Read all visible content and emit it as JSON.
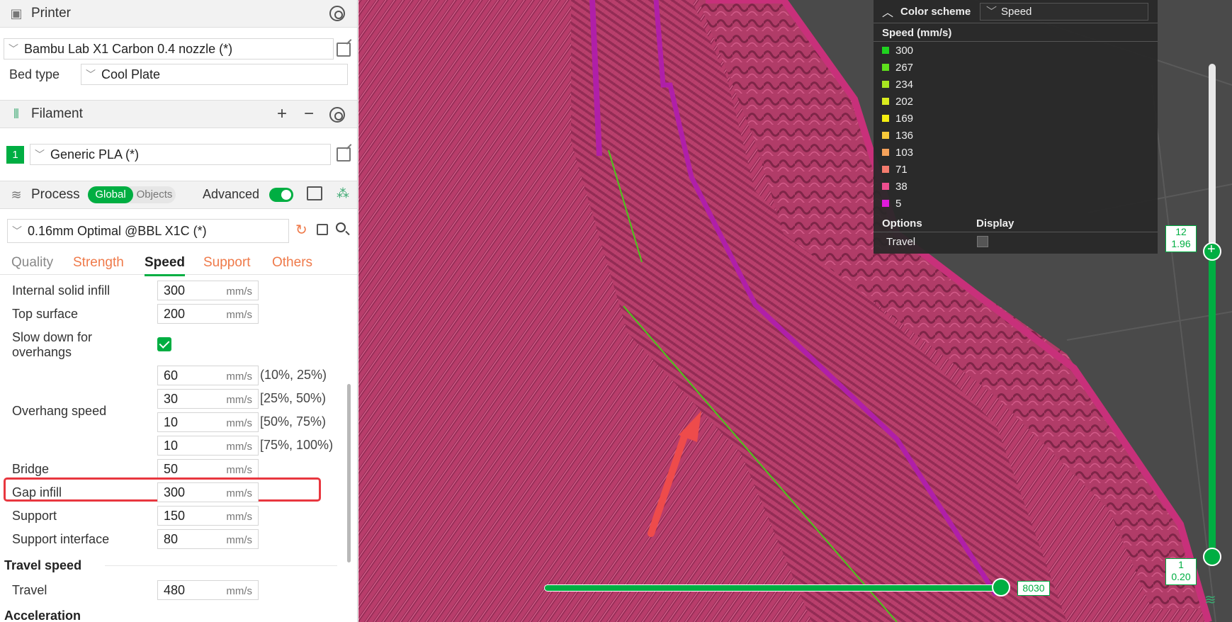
{
  "printer": {
    "title": "Printer",
    "preset": "Bambu Lab X1 Carbon 0.4 nozzle (*)",
    "bed_type_label": "Bed type",
    "bed_type": "Cool Plate"
  },
  "filament": {
    "title": "Filament",
    "slot": "1",
    "preset": "Generic PLA (*)"
  },
  "process": {
    "title": "Process",
    "scope_on": "Global",
    "scope_off": "Objects",
    "advanced_label": "Advanced",
    "preset": "0.16mm Optimal @BBL X1C (*)"
  },
  "tabs": [
    "Quality",
    "Strength",
    "Speed",
    "Support",
    "Others"
  ],
  "speed": {
    "unit": "mm/s",
    "internal_solid_infill": {
      "label": "Internal solid infill",
      "value": "300"
    },
    "top_surface": {
      "label": "Top surface",
      "value": "200"
    },
    "slow_down_label_1": "Slow down for",
    "slow_down_label_2": "overhangs",
    "overhang_label": "Overhang speed",
    "overhangs": [
      {
        "value": "60",
        "range": "(10%, 25%)"
      },
      {
        "value": "30",
        "range": "[25%, 50%)"
      },
      {
        "value": "10",
        "range": "[50%, 75%)"
      },
      {
        "value": "10",
        "range": "[75%, 100%)"
      }
    ],
    "bridge": {
      "label": "Bridge",
      "value": "50"
    },
    "gap_infill": {
      "label": "Gap infill",
      "value": "300"
    },
    "support": {
      "label": "Support",
      "value": "150"
    },
    "support_interface": {
      "label": "Support interface",
      "value": "80"
    },
    "travel_heading": "Travel speed",
    "travel": {
      "label": "Travel",
      "value": "480"
    },
    "acceleration_heading": "Acceleration"
  },
  "legend": {
    "color_scheme_label": "Color scheme",
    "scheme": "Speed",
    "speed_heading": "Speed (mm/s)",
    "items": [
      {
        "value": "300",
        "color": "#1fd21f"
      },
      {
        "value": "267",
        "color": "#5ee01c"
      },
      {
        "value": "234",
        "color": "#a8e620"
      },
      {
        "value": "202",
        "color": "#d9ec1e"
      },
      {
        "value": "169",
        "color": "#f4ee10"
      },
      {
        "value": "136",
        "color": "#f8c93a"
      },
      {
        "value": "103",
        "color": "#f5a25a"
      },
      {
        "value": "71",
        "color": "#f47b6e"
      },
      {
        "value": "38",
        "color": "#ee4e8f"
      },
      {
        "value": "5",
        "color": "#e01adb"
      }
    ],
    "options_label": "Options",
    "display_label": "Display",
    "travel_label": "Travel"
  },
  "sliders": {
    "top_layer": "12",
    "top_height": "1.96",
    "bottom_layer": "1",
    "bottom_height": "0.20",
    "move": "8030"
  }
}
